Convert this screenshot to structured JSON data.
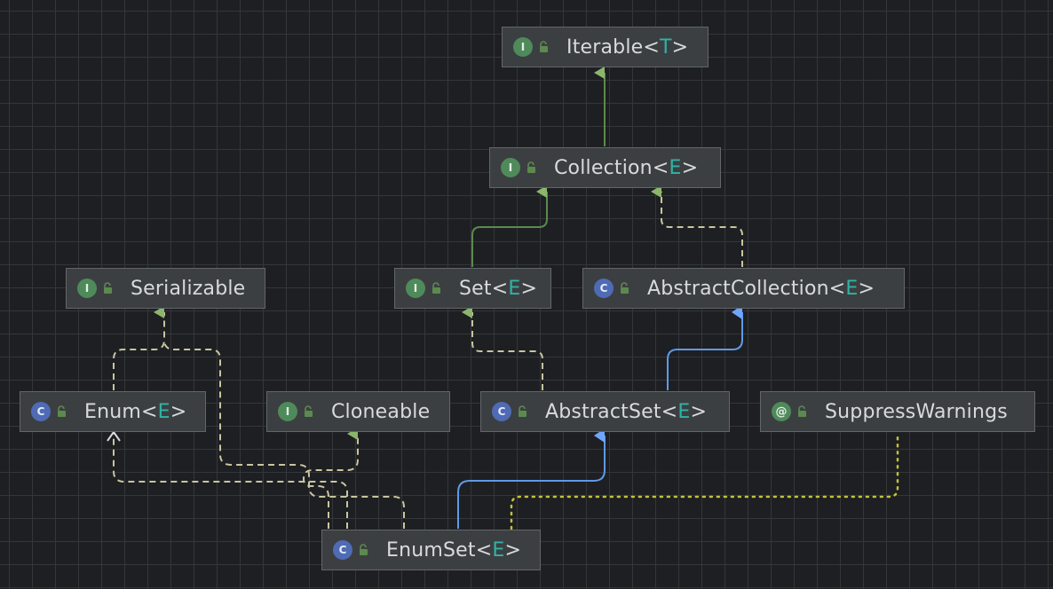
{
  "nodes": {
    "iterable": {
      "kind": "I",
      "name": "Iterable",
      "type_param": "T"
    },
    "collection": {
      "kind": "I",
      "name": "Collection",
      "type_param": "E"
    },
    "serializable": {
      "kind": "I",
      "name": "Serializable",
      "type_param": ""
    },
    "set": {
      "kind": "I",
      "name": "Set",
      "type_param": "E"
    },
    "abstractcollection": {
      "kind": "C",
      "name": "AbstractCollection",
      "type_param": "E"
    },
    "enum": {
      "kind": "C",
      "name": "Enum",
      "type_param": "E"
    },
    "cloneable": {
      "kind": "I",
      "name": "Cloneable",
      "type_param": ""
    },
    "abstractset": {
      "kind": "C",
      "name": "AbstractSet",
      "type_param": "E"
    },
    "suppresswarnings": {
      "kind": "@",
      "name": "SuppressWarnings",
      "type_param": ""
    },
    "enumset": {
      "kind": "C",
      "name": "EnumSet",
      "type_param": "E"
    }
  },
  "colors": {
    "interface_badge": "#4f8a5b",
    "class_badge": "#4f6bb5",
    "type_param": "#2fb3a6",
    "extends_edge": "#5c8a4e",
    "implements_edge": "#c9c5a0",
    "class_extends_edge": "#5f9ae6",
    "annotation_edge": "#c2c23a"
  }
}
